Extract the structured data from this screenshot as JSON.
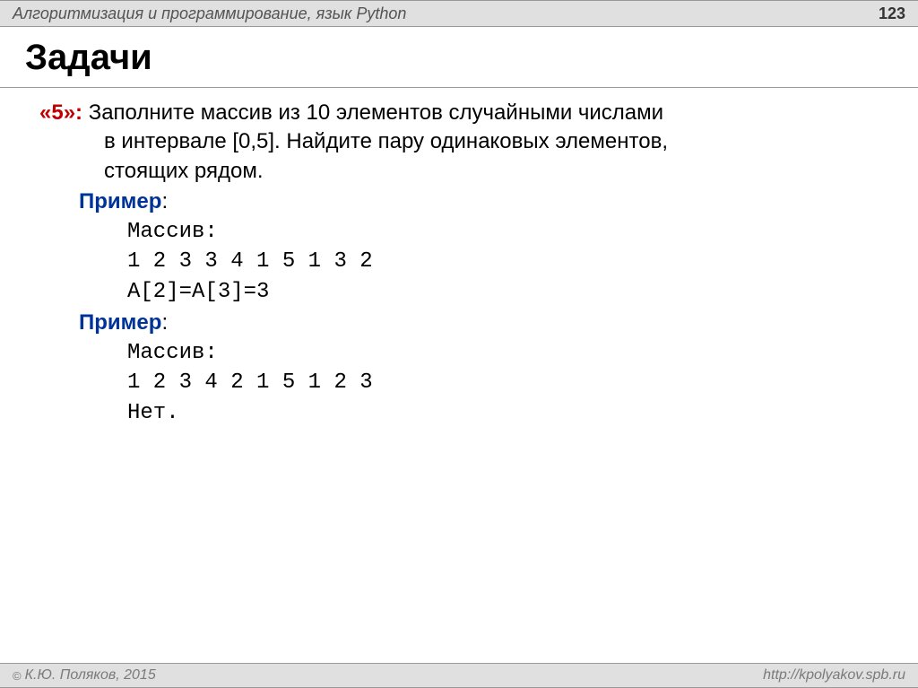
{
  "header": {
    "title": "Алгоритмизация и программирование, язык Python",
    "page_number": "123"
  },
  "main_title": "Задачи",
  "task": {
    "grade": "«5»:",
    "text_line1": " Заполните массив из 10 элементов случайными числами",
    "text_line2": "в интервале [0,5]. Найдите пару одинаковых элементов,",
    "text_line3": "стоящих рядом."
  },
  "example1": {
    "label": "Пример",
    "colon": ":",
    "line1": "Массив:",
    "line2": "1 2 3 3 4 1 5 1 3 2",
    "line3": "A[2]=A[3]=3"
  },
  "example2": {
    "label": "Пример",
    "colon": ":",
    "line1": "Массив:",
    "line2": "1 2 3 4 2 1 5 1 2 3",
    "line3": "Нет."
  },
  "footer": {
    "copyright_symbol": "©",
    "copyright": "К.Ю. Поляков, 2015",
    "url": "http://kpolyakov.spb.ru"
  }
}
